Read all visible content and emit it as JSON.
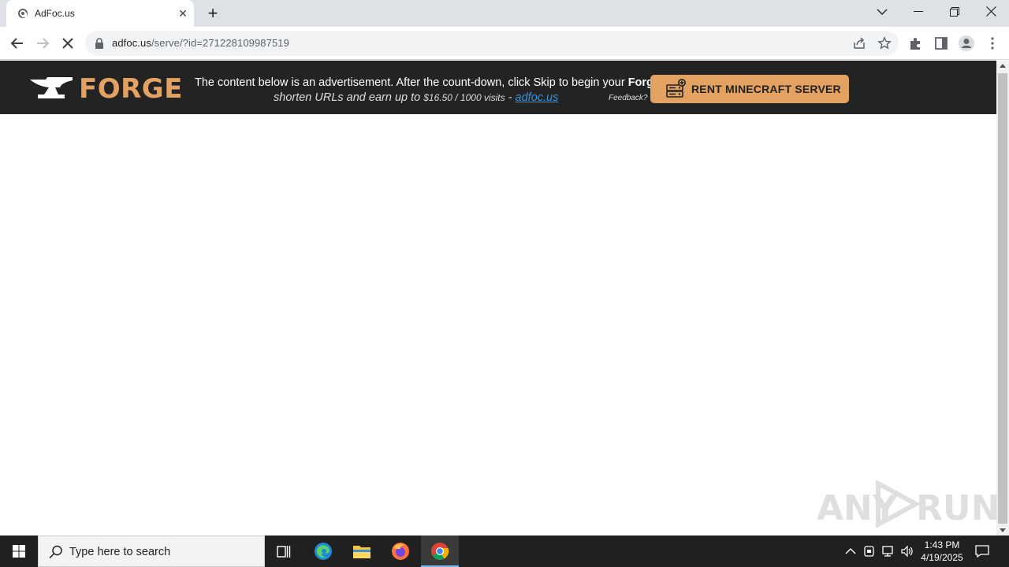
{
  "browser": {
    "tab_title": "AdFoc.us",
    "new_tab": "+",
    "url_host": "adfoc.us",
    "url_rest": "/serve/?id=271228109987519"
  },
  "ad_bar": {
    "logo_text": "FORGE",
    "line1_pre": "The content below is an advertisement. After the count-down, click Skip to begin your ",
    "line1_bold": "Forge",
    "line2_pre": "shorten URLs and earn up to ",
    "line2_small": "$16.50 / 1000 visits",
    "line2_sep": " - ",
    "line2_link": "adfoc.us",
    "feedback": "Feedback?",
    "button_label": "RENT MINECRAFT SERVER"
  },
  "watermark": {
    "left": "ANY",
    "right": "RUN"
  },
  "taskbar": {
    "search_placeholder": "Type here to search",
    "time": "1:43 PM",
    "date": "4/19/2025"
  },
  "colors": {
    "ad_bg": "#232323",
    "forge_orange": "#e4a262",
    "link_blue": "#3d8fd8",
    "taskbar_bg": "#202020"
  }
}
